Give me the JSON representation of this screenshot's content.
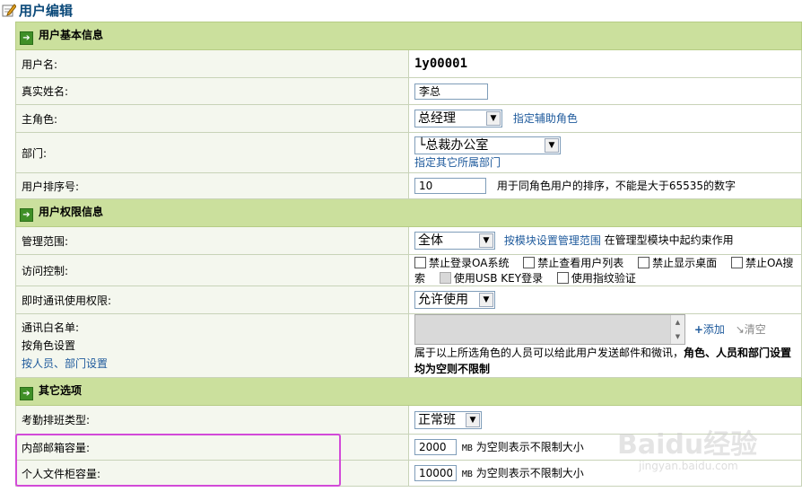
{
  "page": {
    "title": "用户编辑"
  },
  "sections": {
    "basic": "用户基本信息",
    "permission": "用户权限信息",
    "other": "其它选项"
  },
  "basic": {
    "username_label": "用户名:",
    "username_value": "1y00001",
    "realname_label": "真实姓名:",
    "realname_value": "李总",
    "role_label": "主角色:",
    "role_value": "总经理",
    "role_link": "指定辅助角色",
    "dept_label": "部门:",
    "dept_value": "└总裁办公室",
    "dept_link": "指定其它所属部门",
    "sort_label": "用户排序号:",
    "sort_value": "10",
    "sort_hint": "用于同角色用户的排序，不能是大于65535的数字"
  },
  "permission": {
    "scope_label": "管理范围:",
    "scope_value": "全体",
    "scope_link": "按模块设置管理范围",
    "scope_hint": "在管理型模块中起约束作用",
    "access_label": "访问控制:",
    "access_options": [
      "禁止登录OA系统",
      "禁止查看用户列表",
      "禁止显示桌面",
      "禁止OA搜索",
      "使用USB KEY登录",
      "使用指纹验证"
    ],
    "im_label": "即时通讯使用权限:",
    "im_value": "允许使用",
    "whitelist_label_1": "通讯白名单:",
    "whitelist_label_2": "按角色设置",
    "whitelist_label_3": "按人员、部门设置",
    "add_label": "添加",
    "clear_label": "清空",
    "whitelist_hint": "属于以上所选角色的人员可以给此用户发送邮件和微讯，",
    "whitelist_hint_bold": "角色、人员和部门设置均为空则不限制"
  },
  "other": {
    "shift_label": "考勤排班类型:",
    "shift_value": "正常班",
    "mailbox_label": "内部邮箱容量:",
    "mailbox_value": "2000",
    "mailbox_unit": "MB",
    "mailbox_hint": "为空则表示不限制大小",
    "cabinet_label": "个人文件柜容量:",
    "cabinet_value": "10000",
    "cabinet_unit": "MB",
    "cabinet_hint": "为空则表示不限制大小"
  },
  "colors": {
    "section_bg": "#cbe09d",
    "label_bg": "#f4f7ee",
    "link": "#1e5a9c",
    "highlight": "#d24ad8"
  },
  "watermark": {
    "line1": "Baidu经验",
    "line2": "jingyan.baidu.com"
  }
}
